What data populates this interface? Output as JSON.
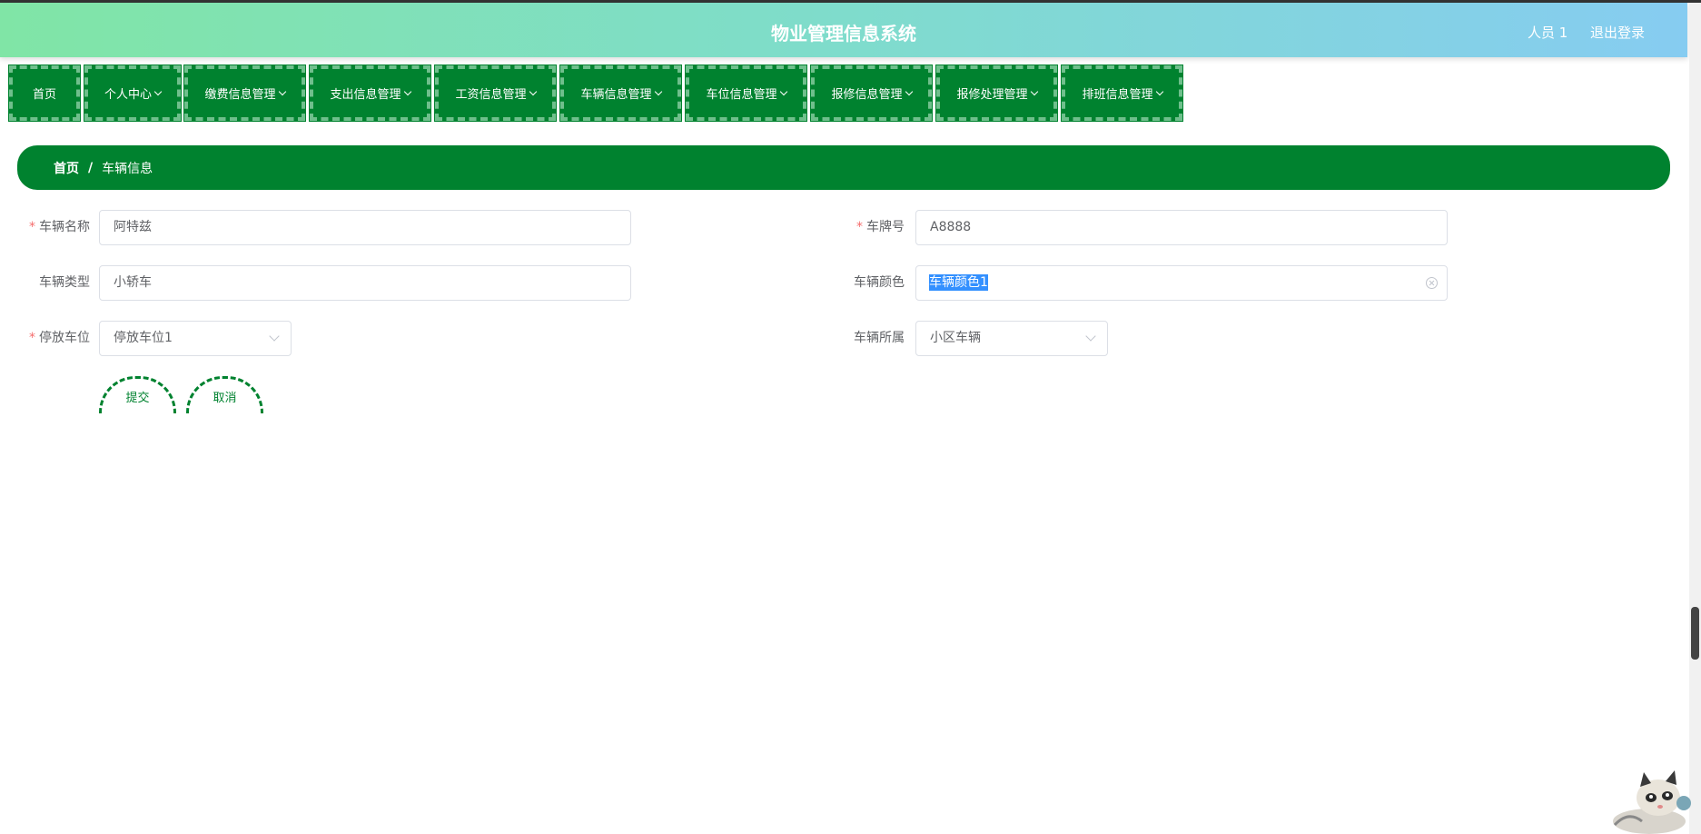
{
  "header": {
    "title": "物业管理信息系统",
    "user": "人员 1",
    "logout": "退出登录"
  },
  "nav": {
    "items": [
      {
        "label": "首页",
        "dropdown": false
      },
      {
        "label": "个人中心",
        "dropdown": true
      },
      {
        "label": "缴费信息管理",
        "dropdown": true
      },
      {
        "label": "支出信息管理",
        "dropdown": true
      },
      {
        "label": "工资信息管理",
        "dropdown": true
      },
      {
        "label": "车辆信息管理",
        "dropdown": true
      },
      {
        "label": "车位信息管理",
        "dropdown": true
      },
      {
        "label": "报修信息管理",
        "dropdown": true
      },
      {
        "label": "报修处理管理",
        "dropdown": true
      },
      {
        "label": "排班信息管理",
        "dropdown": true
      }
    ]
  },
  "breadcrumb": {
    "home": "首页",
    "separator": "/",
    "current": "车辆信息"
  },
  "form": {
    "vehicle_name": {
      "label": "车辆名称",
      "required": true,
      "value": "阿特兹"
    },
    "plate_number": {
      "label": "车牌号",
      "required": true,
      "value": "A8888"
    },
    "vehicle_type": {
      "label": "车辆类型",
      "required": false,
      "value": "小轿车"
    },
    "vehicle_color": {
      "label": "车辆颜色",
      "required": false,
      "value": "车辆颜色1"
    },
    "parking_space": {
      "label": "停放车位",
      "required": true,
      "value": "停放车位1"
    },
    "vehicle_owner": {
      "label": "车辆所属",
      "required": false,
      "value": "小区车辆"
    },
    "submit_label": "提交",
    "cancel_label": "取消"
  },
  "colors": {
    "primary_green": "#00822f",
    "header_gradient_start": "#80e5a6",
    "header_gradient_end": "#86ccf1",
    "required_star": "#f56c6c"
  }
}
